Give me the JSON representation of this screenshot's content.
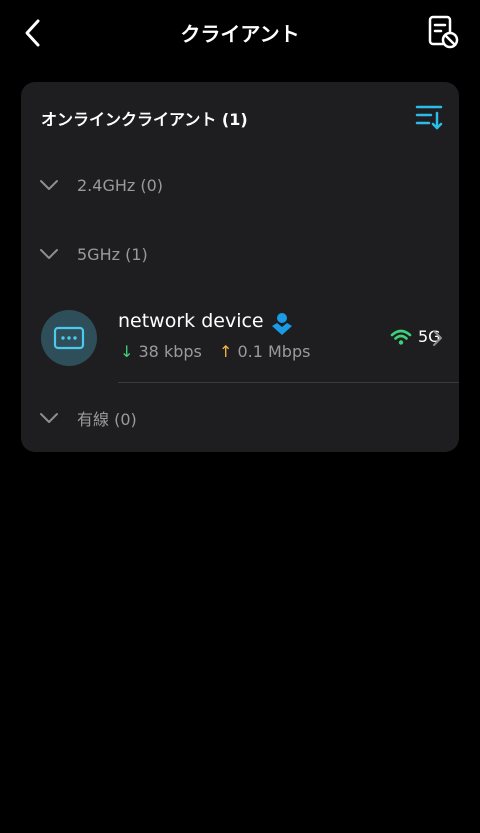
{
  "header": {
    "title": "クライアント",
    "back_icon": "back-icon",
    "block_icon": "blocklist-icon"
  },
  "card": {
    "heading": "オンラインクライアント (1)",
    "accent_color": "#2bbce8",
    "groups": [
      {
        "label": "2.4GHz (0)"
      },
      {
        "label": "5GHz (1)"
      },
      {
        "label": "有線 (0)"
      }
    ],
    "device": {
      "name": "network device",
      "download": "38 kbps",
      "upload": "0.1 Mbps",
      "band": "5G",
      "download_arrow": "↓",
      "upload_arrow": "↑",
      "signal_color": "#3fd17a"
    }
  }
}
